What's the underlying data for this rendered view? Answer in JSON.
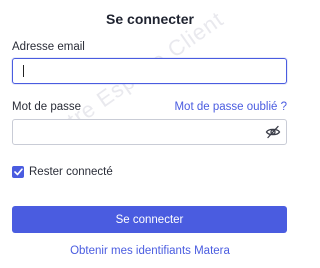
{
  "form": {
    "title": "Se connecter",
    "email_label": "Adresse email",
    "email_value": "",
    "password_label": "Mot de passe",
    "password_value": "",
    "forgot_password": "Mot de passe oublié ?",
    "password_toggle_icon": "eye-slash-icon",
    "remember_label": "Rester connecté",
    "remember_checked": true,
    "submit_label": "Se connecter",
    "credentials_link": "Obtenir mes identifiants Matera"
  },
  "watermark": "Votre Espace Client",
  "colors": {
    "accent": "#4a5ce0",
    "text": "#1f2330",
    "border": "#c9ccd6",
    "watermark": "#e9e9ee"
  }
}
